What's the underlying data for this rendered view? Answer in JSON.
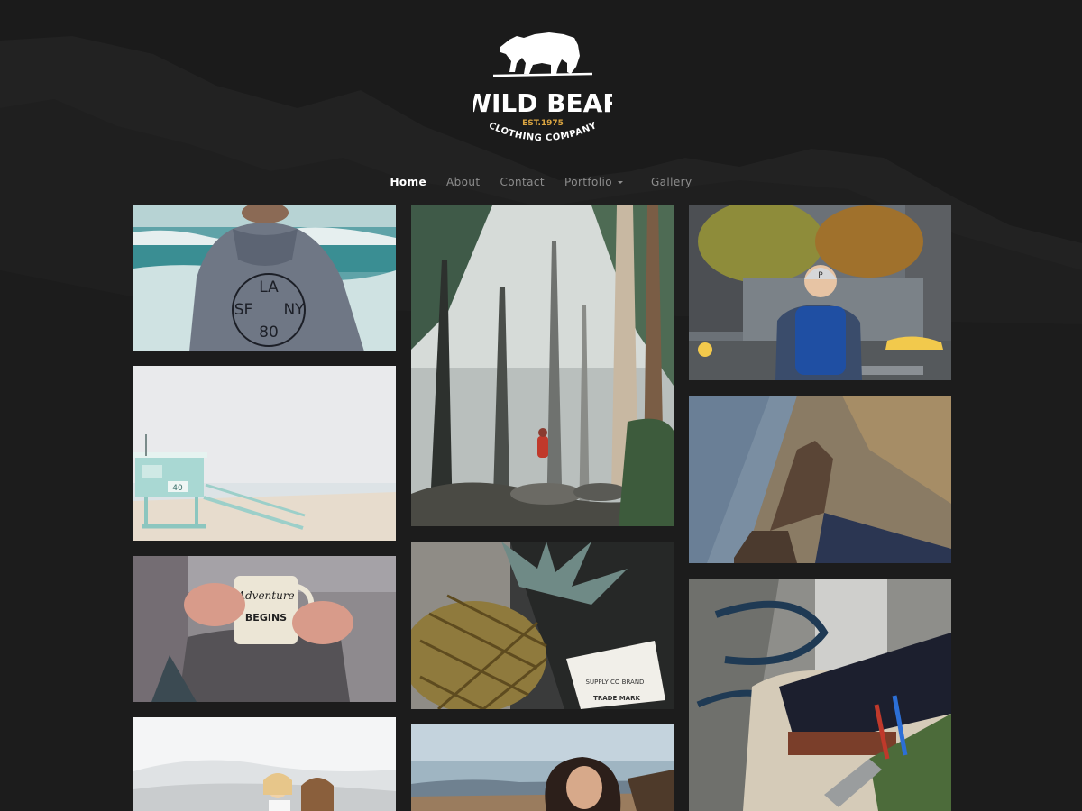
{
  "brand": {
    "name": "WILD BEAR",
    "established": "EST.1975",
    "tagline": "CLOTHING COMPANY",
    "accent": "#d9a441"
  },
  "nav": {
    "items": [
      {
        "label": "Home",
        "active": true
      },
      {
        "label": "About",
        "active": false
      },
      {
        "label": "Contact",
        "active": false
      },
      {
        "label": "Portfolio",
        "active": false,
        "has_dropdown": true
      },
      {
        "label": "Gallery",
        "active": false
      }
    ]
  },
  "gallery": {
    "photos": [
      {
        "subject": "hoodie-beach",
        "print_lines": [
          "LA",
          "SF",
          "NY",
          "80"
        ]
      },
      {
        "subject": "lifeguard-tower",
        "tower_number": "40"
      },
      {
        "subject": "adventure-mug",
        "mug_lines": [
          "Adventure",
          "BEGINS"
        ]
      },
      {
        "subject": "beach-friends"
      },
      {
        "subject": "forest-hiker"
      },
      {
        "subject": "pineapple-tag",
        "tag_lines": [
          "SUPPLY CO BRAND",
          "TRADE MARK"
        ]
      },
      {
        "subject": "woman-portrait"
      },
      {
        "subject": "city-backpacker",
        "cap_letter": "P"
      },
      {
        "subject": "cliff-boots"
      },
      {
        "subject": "tool-bag"
      }
    ]
  },
  "colors": {
    "background": "#1c1c1c",
    "nav_inactive": "#8d8d8d",
    "nav_active": "#ffffff"
  }
}
